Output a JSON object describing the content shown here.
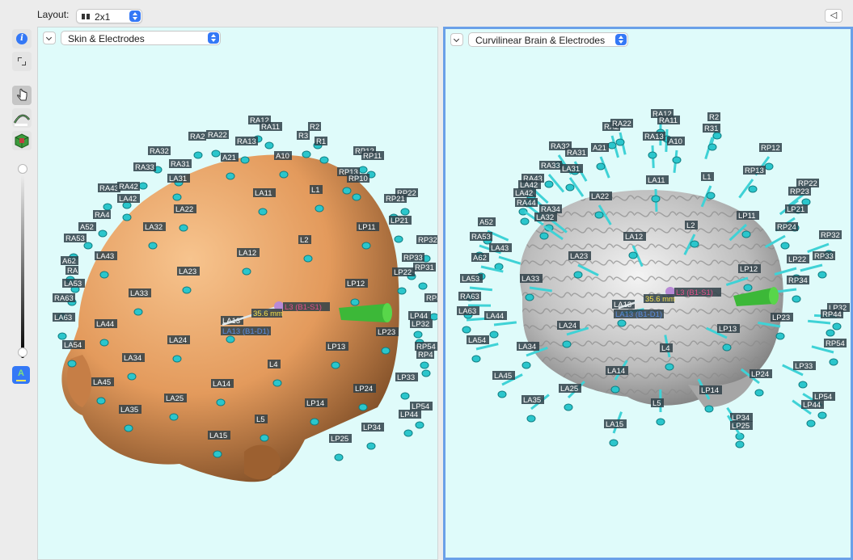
{
  "toolbar": {
    "layout_label": "Layout:",
    "layout_value": "2x1",
    "collapse_glyph": "◁"
  },
  "tools": {
    "info_icon": "i",
    "a_label": "A"
  },
  "viewports": {
    "left": {
      "title": "Skin & Electrodes"
    },
    "right": {
      "title": "Curvilinear Brain & Electrodes"
    }
  },
  "electrodes_left": [
    "RA12",
    "RA11",
    "R2",
    "R3",
    "R1",
    "RA2",
    "RA22",
    "RA13",
    "RA32",
    "A21",
    "A10",
    "RP12",
    "RP11",
    "RA33",
    "RA31",
    "RP13",
    "RP10",
    "LA31",
    "RA43",
    "RA42",
    "LA11",
    "L1",
    "RP22",
    "RP21",
    "LA42",
    "RA4",
    "LA22",
    "LP21",
    "A52",
    "LA32",
    "LP11",
    "RA53",
    "L2",
    "RP32",
    "LA12",
    "RP33",
    "A62",
    "LA43",
    "RP31",
    "RA",
    "LP22",
    "LA23",
    "LA53",
    "LP12",
    "LA33",
    "RP4",
    "RA63",
    "LA63",
    "LP44",
    "LA13",
    "LP32",
    "LA44",
    "LP23",
    "LA54",
    "LP13",
    "LA24",
    "RP54",
    "RP4",
    "LA34",
    "L4",
    "LP33",
    "LA45",
    "LA14",
    "LP24",
    "LA25",
    "LA35",
    "LP14",
    "LP54",
    "LP44",
    "L5",
    "LP34",
    "LA15",
    "LP25"
  ],
  "electrodes_right": [
    "RA12",
    "RA11",
    "R2",
    "RA2",
    "RA22",
    "R31",
    "RA13",
    "A10",
    "RA32",
    "A21",
    "RP12",
    "RA31",
    "RA33",
    "LA31",
    "RA43",
    "LA11",
    "L1",
    "RP13",
    "LA42",
    "LA42",
    "RP22",
    "RA44",
    "LA22",
    "RP23",
    "RA34",
    "LA32",
    "LP21",
    "A52",
    "LP11",
    "RP24",
    "RA53",
    "LA43",
    "L2",
    "LA12",
    "RP32",
    "A62",
    "LA23",
    "LP22",
    "RP33",
    "LA53",
    "LP12",
    "LA33",
    "RP34",
    "RA63",
    "LA13",
    "LP32",
    "LA63",
    "LA44",
    "LP23",
    "RP44",
    "LA24",
    "LP13",
    "LA54",
    "LA34",
    "L4",
    "RP54",
    "LP33",
    "LA45",
    "LA14",
    "LP24",
    "LA25",
    "LA35",
    "LP14",
    "LP54",
    "LP44",
    "L5",
    "LP34",
    "LA15",
    "LP25"
  ],
  "measurement": {
    "left": {
      "distance": "35.6 mm",
      "label_a": "L3 (B1-S1)",
      "label_b": "LA13 (B1-D1)"
    },
    "right": {
      "distance": "35.6 mm",
      "label_a": "L3 (B1-S1)",
      "label_b": "LA13 (B1-D1)"
    }
  },
  "colors": {
    "viewport_bg": "#dffbfa",
    "electrode": "#40d4d8",
    "skin": "#e8a06a",
    "brain": "#c8c8c8",
    "accent": "#3478f6"
  }
}
